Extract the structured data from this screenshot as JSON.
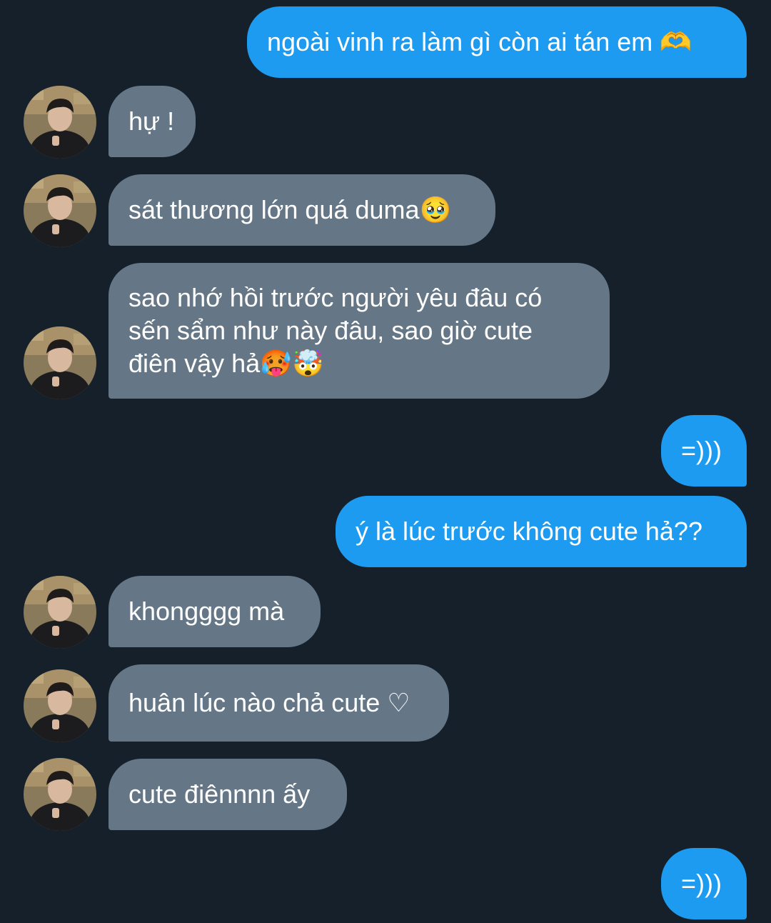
{
  "messages": [
    {
      "direction": "out",
      "text": "ngoài vinh ra làm gì còn ai tán em 🫶"
    },
    {
      "direction": "in",
      "text": "hự !"
    },
    {
      "direction": "in",
      "text": "sát thương lớn quá duma🥹"
    },
    {
      "direction": "in",
      "text": "sao nhớ hồi trước người yêu đâu có sến sẩm như này đâu, sao giờ cute điên vậy hả🥵🤯"
    },
    {
      "direction": "out",
      "text": "=)))"
    },
    {
      "direction": "out",
      "text": "ý là lúc trước không cute hả??"
    },
    {
      "direction": "in",
      "text": "khongggg mà"
    },
    {
      "direction": "in",
      "text": "huân lúc nào chả cute ♡"
    },
    {
      "direction": "in",
      "text": "cute điênnnn ấy"
    },
    {
      "direction": "out",
      "text": "=)))"
    }
  ],
  "avatar_icon": "contact-avatar-photo",
  "colors": {
    "background": "#15202b",
    "outgoing_bubble": "#1d9bf0",
    "incoming_bubble": "#657786",
    "text": "#ffffff"
  }
}
